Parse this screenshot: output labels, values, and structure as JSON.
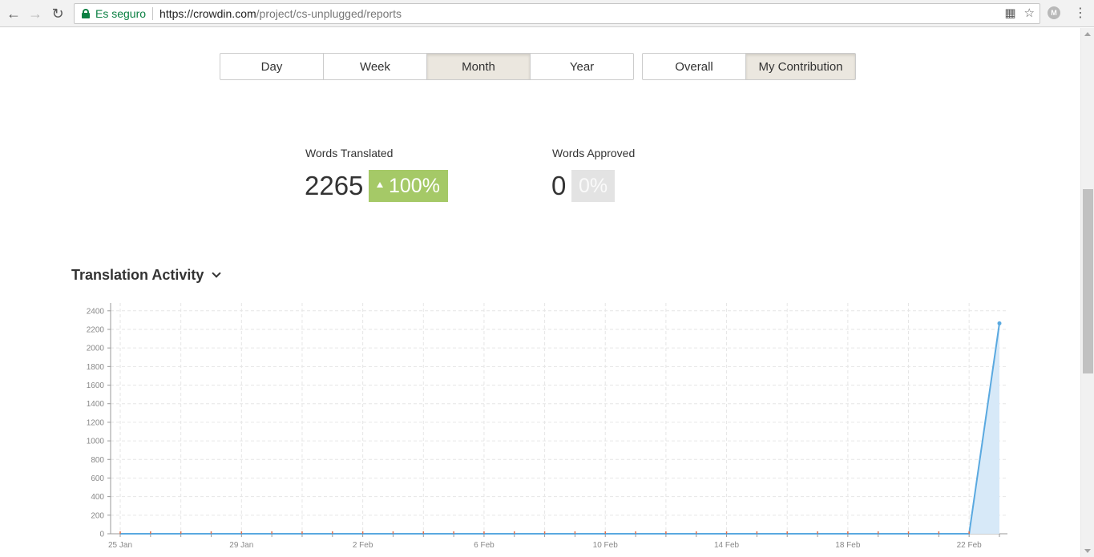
{
  "browser": {
    "secure_label": "Es seguro",
    "url_host": "https://crowdin.com",
    "url_path": "/project/cs-unplugged/reports",
    "extension_letter": "M"
  },
  "period_tabs": [
    "Day",
    "Week",
    "Month",
    "Year"
  ],
  "period_active": "Month",
  "scope_tabs": [
    "Overall",
    "My Contribution"
  ],
  "scope_active": "My Contribution",
  "stats": {
    "translated": {
      "label": "Words Translated",
      "value": "2265",
      "change": "100%"
    },
    "approved": {
      "label": "Words Approved",
      "value": "0",
      "change": "0%"
    }
  },
  "section_title": "Translation Activity",
  "colors": {
    "line": "#5aa9e0",
    "area": "#d7e9f8",
    "marker": "#e0704a",
    "badge_up": "#a5c967",
    "badge_zero": "#e3e3e3"
  },
  "chart_data": {
    "type": "area",
    "x": [
      "25 Jan",
      "26 Jan",
      "27 Jan",
      "28 Jan",
      "29 Jan",
      "30 Jan",
      "31 Jan",
      "1 Feb",
      "2 Feb",
      "3 Feb",
      "4 Feb",
      "5 Feb",
      "6 Feb",
      "7 Feb",
      "8 Feb",
      "9 Feb",
      "10 Feb",
      "11 Feb",
      "12 Feb",
      "13 Feb",
      "14 Feb",
      "15 Feb",
      "16 Feb",
      "17 Feb",
      "18 Feb",
      "19 Feb",
      "20 Feb",
      "21 Feb",
      "22 Feb",
      "23 Feb"
    ],
    "values": [
      0,
      0,
      0,
      0,
      0,
      0,
      0,
      0,
      0,
      0,
      0,
      0,
      0,
      0,
      0,
      0,
      0,
      0,
      0,
      0,
      0,
      0,
      0,
      0,
      0,
      0,
      0,
      0,
      0,
      2265
    ],
    "x_tick_labels": [
      "25 Jan",
      "29 Jan",
      "2 Feb",
      "6 Feb",
      "10 Feb",
      "14 Feb",
      "18 Feb",
      "22 Feb"
    ],
    "y_ticks": [
      0,
      200,
      400,
      600,
      800,
      1000,
      1200,
      1400,
      1600,
      1800,
      2000,
      2200,
      2400
    ],
    "ylim": [
      0,
      2450
    ],
    "grid": true
  }
}
